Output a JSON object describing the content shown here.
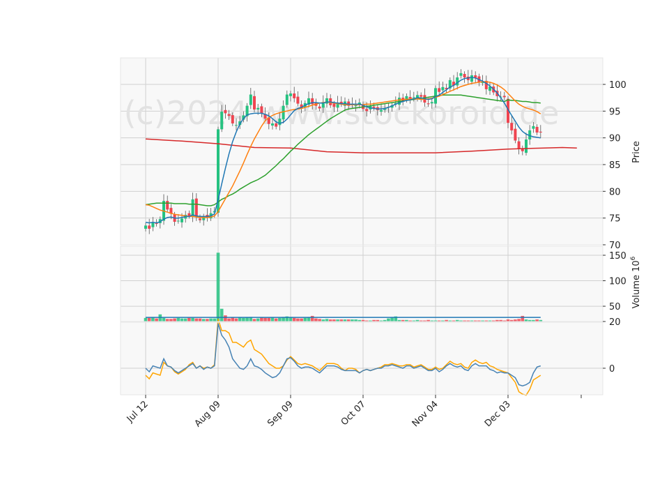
{
  "watermark": "(c)2024 www.stockoroid.de",
  "chart_data": {
    "type": "candlestick",
    "colors": {
      "up": "#26c281",
      "down": "#ef4450",
      "sma_short": "#1f77b4",
      "sma_mid": "#ff7f0e",
      "sma_long": "#2ca02c",
      "sma_200": "#d62728",
      "osc_a": "#4682b4",
      "osc_b": "#ffa500",
      "vol_avg": "#1f77b4",
      "grid": "#d0d0d0",
      "panel_bg": "#f8f8f8"
    },
    "x_ticks": [
      {
        "label": "Jul 12",
        "i": 0
      },
      {
        "label": "Aug 09",
        "i": 20
      },
      {
        "label": "Sep 09",
        "i": 40
      },
      {
        "label": "Oct 07",
        "i": 60
      },
      {
        "label": "Nov 04",
        "i": 80
      },
      {
        "label": "Dec 03",
        "i": 100
      }
    ],
    "price_panel": {
      "ylabel": "Price",
      "ylim": [
        70,
        105
      ],
      "yticks": [
        70,
        75,
        80,
        85,
        90,
        95,
        100
      ],
      "close": [
        73.6,
        73.0,
        74.2,
        73.9,
        74.8,
        78.2,
        76.6,
        75.8,
        74.3,
        74.5,
        74.9,
        75.6,
        75.4,
        78.5,
        75.2,
        74.6,
        75.3,
        75.1,
        75.9,
        76.3,
        91.6,
        94.9,
        94.6,
        94.1,
        92.7,
        92.4,
        93.1,
        94.2,
        96.0,
        98.1,
        95.3,
        95.6,
        94.6,
        93.6,
        92.6,
        92.7,
        92.1,
        93.6,
        96.0,
        98.1,
        98.3,
        97.4,
        96.4,
        95.6,
        96.5,
        97.4,
        96.3,
        96.0,
        95.5,
        96.7,
        97.4,
        96.1,
        95.8,
        96.6,
        96.3,
        96.8,
        96.0,
        96.1,
        96.1,
        96.6,
        95.4,
        95.0,
        96.0,
        95.6,
        95.2,
        95.2,
        95.4,
        95.8,
        96.1,
        96.5,
        97.5,
        96.8,
        97.8,
        97.4,
        97.6,
        98.0,
        97.7,
        96.6,
        96.3,
        96.7,
        99.3,
        98.6,
        99.5,
        99.1,
        100.8,
        99.8,
        101.3,
        102.1,
        101.3,
        100.8,
        101.7,
        101.2,
        100.4,
        100.5,
        99.1,
        99.6,
        98.5,
        97.8,
        97.7,
        97.6,
        92.8,
        91.4,
        89.5,
        87.9,
        87.5,
        89.7,
        91.4,
        92.2,
        91.0,
        91.0
      ],
      "sma_short": [
        74.2,
        74.1,
        74.2,
        74.1,
        74.3,
        74.8,
        75.1,
        75.2,
        75.0,
        75.0,
        75.1,
        75.3,
        75.3,
        75.6,
        75.4,
        75.3,
        75.3,
        75.3,
        75.4,
        75.8,
        78.4,
        81.4,
        84.3,
        87.0,
        89.3,
        91.1,
        92.6,
        93.6,
        94.3,
        94.5,
        94.6,
        94.6,
        94.6,
        94.4,
        94.1,
        93.6,
        93.0,
        92.7,
        92.9,
        93.5,
        94.3,
        95.1,
        95.5,
        95.7,
        96.1,
        96.4,
        96.6,
        96.6,
        96.5,
        96.5,
        96.7,
        96.7,
        96.6,
        96.5,
        96.4,
        96.4,
        96.3,
        96.3,
        96.3,
        96.3,
        96.1,
        95.8,
        95.6,
        95.5,
        95.4,
        95.4,
        95.5,
        95.7,
        96.0,
        96.3,
        96.6,
        96.8,
        97.0,
        97.1,
        97.3,
        97.5,
        97.5,
        97.3,
        97.2,
        97.3,
        97.7,
        98.0,
        98.5,
        99.0,
        99.5,
        99.8,
        100.3,
        100.8,
        101.1,
        101.2,
        101.3,
        101.2,
        100.9,
        100.6,
        100.2,
        99.7,
        99.1,
        98.4,
        97.5,
        96.5,
        95.3,
        94.2,
        93.1,
        92.0,
        91.2,
        90.7,
        90.4,
        90.2,
        90.1,
        90.0
      ],
      "sma_mid": [
        77.5,
        77.4,
        77.1,
        76.8,
        76.5,
        76.3,
        76.1,
        75.9,
        75.7,
        75.6,
        75.5,
        75.4,
        75.3,
        75.3,
        75.2,
        75.1,
        75.1,
        75.1,
        75.2,
        75.4,
        76.2,
        77.4,
        78.6,
        79.8,
        81.0,
        82.4,
        83.8,
        85.3,
        86.9,
        88.4,
        89.8,
        91.0,
        92.2,
        93.2,
        93.8,
        94.2,
        94.5,
        94.7,
        94.9,
        95.0,
        95.2,
        95.3,
        95.4,
        95.5,
        95.7,
        95.9,
        96.1,
        96.3,
        96.5,
        96.6,
        96.7,
        96.6,
        96.5,
        96.4,
        96.3,
        96.2,
        96.2,
        96.2,
        96.2,
        96.2,
        96.2,
        96.3,
        96.3,
        96.4,
        96.5,
        96.6,
        96.7,
        96.8,
        96.9,
        97.0,
        97.1,
        97.2,
        97.2,
        97.3,
        97.3,
        97.3,
        97.2,
        97.2,
        97.3,
        97.4,
        97.6,
        97.8,
        98.1,
        98.4,
        98.7,
        99.0,
        99.3,
        99.6,
        99.8,
        100.0,
        100.2,
        100.3,
        100.4,
        100.5,
        100.5,
        100.4,
        100.2,
        99.9,
        99.5,
        99.0,
        98.3,
        97.6,
        96.9,
        96.3,
        95.9,
        95.6,
        95.4,
        95.2,
        94.9,
        94.5
      ],
      "sma_long": [
        77.5,
        77.6,
        77.7,
        77.8,
        77.8,
        77.8,
        77.8,
        77.8,
        77.7,
        77.7,
        77.7,
        77.7,
        77.6,
        77.6,
        77.6,
        77.5,
        77.4,
        77.3,
        77.3,
        77.5,
        78.0,
        78.5,
        78.8,
        79.2,
        79.5,
        79.9,
        80.4,
        80.8,
        81.2,
        81.6,
        81.9,
        82.2,
        82.6,
        83.0,
        83.6,
        84.2,
        84.8,
        85.5,
        86.1,
        86.8,
        87.5,
        88.1,
        88.8,
        89.4,
        90.0,
        90.6,
        91.1,
        91.6,
        92.1,
        92.6,
        93.1,
        93.6,
        94.0,
        94.4,
        94.8,
        95.2,
        95.4,
        95.5,
        95.6,
        95.7,
        95.8,
        95.9,
        96.0,
        96.1,
        96.2,
        96.3,
        96.4,
        96.5,
        96.6,
        96.7,
        96.8,
        96.9,
        97.0,
        97.1,
        97.2,
        97.3,
        97.4,
        97.5,
        97.6,
        97.7,
        97.8,
        97.9,
        98.0,
        98.0,
        98.0,
        98.0,
        98.0,
        98.0,
        97.9,
        97.8,
        97.7,
        97.6,
        97.5,
        97.4,
        97.3,
        97.2,
        97.1,
        97.0,
        96.9,
        96.8,
        97.1,
        97.0,
        97.0,
        96.9,
        96.8,
        96.8,
        96.7,
        96.6,
        96.6,
        96.5
      ],
      "sma_200_points": [
        [
          0,
          89.8
        ],
        [
          10,
          89.4
        ],
        [
          20,
          88.9
        ],
        [
          30,
          88.2
        ],
        [
          40,
          88.1
        ],
        [
          50,
          87.4
        ],
        [
          60,
          87.2
        ],
        [
          70,
          87.2
        ],
        [
          80,
          87.2
        ],
        [
          90,
          87.5
        ],
        [
          100,
          87.9
        ],
        [
          110,
          88.1
        ],
        [
          115,
          88.2
        ],
        [
          119,
          88.1
        ]
      ]
    },
    "volume_panel": {
      "ylabel": "Volume",
      "unit_label": "10",
      "unit_exp": "6",
      "ylim": [
        20,
        160
      ],
      "yticks": [
        20,
        50,
        100,
        150
      ],
      "avg_level": 28,
      "values": [
        27,
        27,
        28,
        26,
        34,
        27,
        25,
        25,
        26,
        27,
        26,
        26,
        27,
        27,
        26,
        26,
        25,
        25,
        26,
        26,
        155,
        45,
        32,
        26,
        28,
        26,
        28,
        27,
        28,
        29,
        25,
        26,
        28,
        27,
        27,
        28,
        26,
        27,
        29,
        30,
        29,
        27,
        26,
        26,
        27,
        28,
        31,
        26,
        25,
        24,
        25,
        24,
        24,
        24,
        24,
        24,
        24,
        24,
        24,
        23,
        23,
        22,
        22,
        23,
        23,
        22,
        23,
        26,
        28,
        30,
        23,
        23,
        23,
        22,
        22,
        23,
        22,
        22,
        23,
        22,
        22,
        22,
        22,
        23,
        22,
        22,
        23,
        22,
        22,
        22,
        22,
        22,
        22,
        22,
        22,
        22,
        22,
        23,
        23,
        22,
        24,
        23,
        24,
        25,
        31,
        24,
        23,
        23,
        24,
        23
      ]
    },
    "oscillator_panel": {
      "ylim": [
        -12,
        22
      ],
      "yticks": [
        0
      ],
      "series_a": [
        0,
        -1.5,
        1,
        0.5,
        0,
        4,
        1,
        0.5,
        -1,
        -2,
        -1,
        0,
        1,
        2,
        0,
        1,
        -0.5,
        0.5,
        0,
        1,
        19,
        14,
        12,
        9,
        4,
        2,
        0,
        -0.5,
        1,
        4,
        1,
        0.5,
        -0.5,
        -2,
        -3,
        -4,
        -3.5,
        -2,
        1,
        4,
        4.5,
        3,
        1,
        0,
        0.5,
        0.5,
        0,
        -1,
        -2,
        -0.5,
        1,
        1,
        1,
        0.5,
        -0.5,
        -1,
        -1,
        -1,
        -1,
        -2,
        -1,
        -0.5,
        -1,
        -0.5,
        0,
        0,
        1,
        1,
        1.5,
        1,
        0.5,
        0,
        1,
        1,
        0,
        0.5,
        1,
        0,
        -1,
        -1,
        0,
        -1.5,
        -0.5,
        1,
        2,
        1,
        0.5,
        1,
        -0.5,
        -1,
        1,
        2,
        1,
        1,
        1,
        -0.5,
        -1,
        -2,
        -1.5,
        -2,
        -2,
        -3,
        -4,
        -7,
        -7.5,
        -7,
        -6,
        -2,
        0.5,
        1
      ],
      "series_b": [
        -3,
        -4.5,
        -2,
        -2.5,
        -3,
        2.5,
        1,
        0.5,
        -1.5,
        -2.5,
        -1.5,
        -0.5,
        1.5,
        2.5,
        0,
        1,
        0,
        0.5,
        0,
        1.5,
        21,
        16,
        16,
        15,
        11,
        11,
        10,
        9,
        11,
        12,
        8,
        7,
        6,
        4,
        2,
        1,
        0,
        0,
        1,
        3.5,
        5,
        3.5,
        2,
        1.5,
        2,
        1.5,
        1,
        0,
        -1,
        0.5,
        2,
        2,
        2,
        1.5,
        0,
        -1,
        0,
        0,
        -0.5,
        -2,
        -1,
        -0.5,
        -1,
        -0.5,
        0,
        0.5,
        1.5,
        1.5,
        2,
        1.5,
        1,
        1,
        1.5,
        1.5,
        0.5,
        1,
        1.5,
        0.5,
        -0.5,
        -0.5,
        0.5,
        -0.5,
        0,
        1.5,
        3,
        2,
        1.5,
        2,
        0.5,
        0,
        2.5,
        3.5,
        2.5,
        2,
        2.5,
        1,
        0.5,
        -0.5,
        -1,
        -1.5,
        -2,
        -4,
        -6,
        -10,
        -11,
        -11.5,
        -9,
        -5,
        -4,
        -3
      ]
    }
  }
}
